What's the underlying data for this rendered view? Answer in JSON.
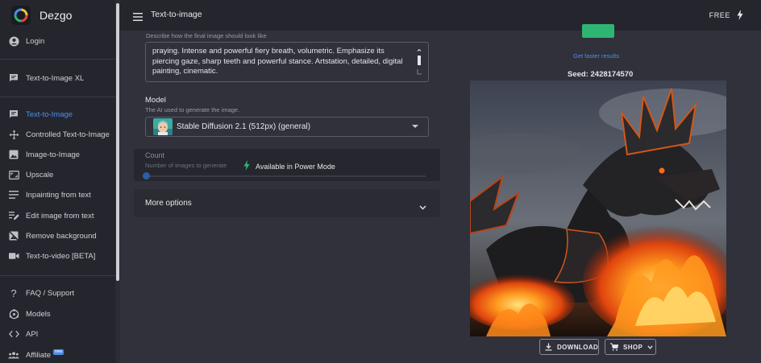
{
  "app": {
    "name": "Dezgo",
    "page_title": "Text-to-image",
    "plan": "FREE"
  },
  "sidebar": {
    "login": "Login",
    "xl": "Text-to-Image XL",
    "items": [
      "Text-to-Image",
      "Controlled Text-to-Image",
      "Image-to-Image",
      "Upscale",
      "Inpainting from text",
      "Edit image from text",
      "Remove background",
      "Text-to-video [BETA]"
    ],
    "active_index": 0,
    "bottom": [
      "FAQ / Support",
      "Models",
      "API",
      "Affiliate"
    ],
    "affiliate_badge": "new"
  },
  "prompt": {
    "help": "Describe how the final image should look like",
    "value": "praying. Intense and powerful fiery breath, volumetric. Emphasize its piercing gaze, sharp teeth and powerful stance. Artstation, detailed, digital painting, cinematic."
  },
  "model": {
    "label": "Model",
    "help": "The AI used to generate the image.",
    "value": "Stable Diffusion 2.1 (512px) (general)"
  },
  "count": {
    "label": "Count",
    "help": "Number of images to generate",
    "notice": "Available in Power Mode"
  },
  "more_options": "More options",
  "result": {
    "faster": "Get faster results",
    "seed": "Seed: 2428174570",
    "download": "DOWNLOAD",
    "shop": "SHOP"
  },
  "colors": {
    "accent": "#4d8fe8",
    "green": "#2fb573",
    "background": "#30313a",
    "sidebar": "#25262d"
  },
  "icons": {
    "login": "account-circle-icon",
    "xl": "chat-bubble-icon",
    "text_to_image": "chat-bubble-icon",
    "controlled": "move-icon",
    "image_to_image": "image-icon",
    "upscale": "aspect-ratio-icon",
    "inpainting": "subject-icon",
    "edit": "edit-note-icon",
    "remove_bg": "hide-image-icon",
    "video": "videocam-icon",
    "faq": "help-icon",
    "models": "hub-icon",
    "api": "code-icon",
    "affiliate": "groups-icon"
  }
}
